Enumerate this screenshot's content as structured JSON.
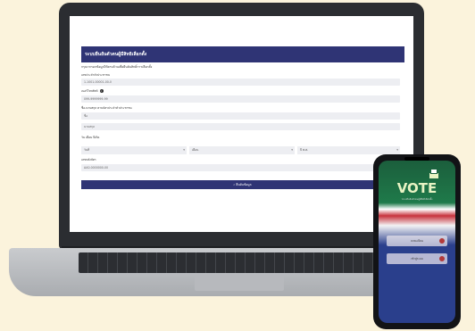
{
  "form": {
    "header": "ระบบยืนยันตัวตนผู้มีสิทธิเลือกตั้ง",
    "intro": "กรุณากรอกข้อมูลให้ครบถ้วนเพื่อยืนยันสิทธิ์การเลือกตั้ง",
    "id_label": "เลขประจำตัวประชาชน",
    "id_value": "1-1001-00001-00-0",
    "phone_label": "เบอร์โทรศัพท์",
    "phone_value": "099-9999999-99",
    "name_label": "ชื่อ-นามสกุล ตามบัตรประจำตัวประชาชน",
    "firstname_value": "ชื่อ",
    "lastname_value": "นามสกุล",
    "birth_label": "วัน เดือน ปีเกิด",
    "day_value": "วันที่",
    "month_value": "เดือน",
    "year_value": "ปี พ.ศ.",
    "laser_label": "เลขหลังบัตร",
    "laser_value": "AA0-0000000-00",
    "submit_label": "ยืนยันข้อมูล"
  },
  "phone": {
    "logo_text": "VOTE",
    "subtitle": "ระบบยืนยันตัวตนผู้มีสิทธิเลือกตั้ง",
    "button1": "ลงทะเบียน",
    "button2": "เข้าสู่ระบบ"
  },
  "colors": {
    "header_bg": "#2f3475",
    "page_bg": "#fbf3dc",
    "logo": "#e8f3c4"
  }
}
